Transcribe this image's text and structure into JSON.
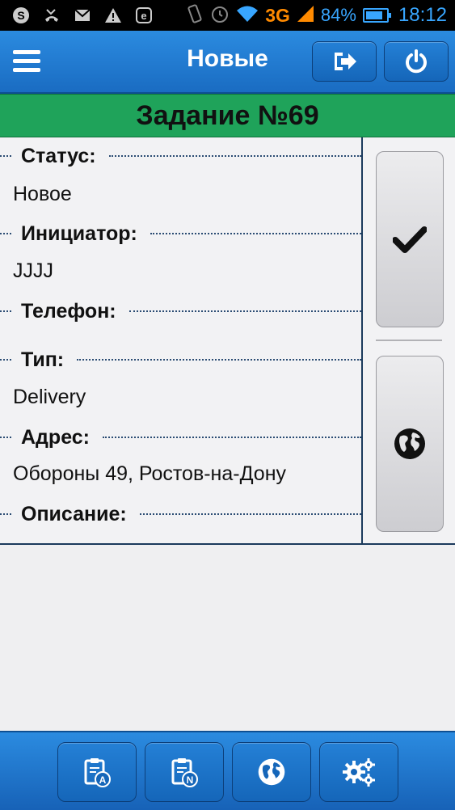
{
  "status_bar": {
    "network": "3G",
    "battery": "84%",
    "battery_level": 0.84,
    "time": "18:12",
    "icons": [
      "skype-icon",
      "missed-call-icon",
      "gmail-icon",
      "warning-icon",
      "e-icon",
      "vibrate-icon",
      "alarm-icon",
      "wifi-icon",
      "signal-icon",
      "battery-icon"
    ]
  },
  "header": {
    "title": "Новые",
    "icons": [
      "menu-icon",
      "logout-icon",
      "power-icon"
    ]
  },
  "task": {
    "title": "Задание №69",
    "fields": [
      {
        "label": "Статус:",
        "value": "Новое"
      },
      {
        "label": "Инициатор:",
        "value": "JJJJ"
      },
      {
        "label": "Телефон:",
        "value": ""
      },
      {
        "label": "Тип:",
        "value": "Delivery"
      },
      {
        "label": "Адрес:",
        "value": "Обороны 49, Ростов-на-Дону"
      },
      {
        "label": "Описание:",
        "value": ""
      }
    ]
  },
  "side_actions": {
    "icons": [
      "checkmark-icon",
      "globe-icon"
    ]
  },
  "bottom_nav": {
    "icons": [
      "clipboard-a-icon",
      "clipboard-n-icon",
      "globe-icon",
      "gears-icon"
    ]
  },
  "colors": {
    "header_blue": "#1a6cc2",
    "task_green": "#1fa35a",
    "battery_blue": "#38a6ff",
    "network_orange": "#ff8a00"
  }
}
